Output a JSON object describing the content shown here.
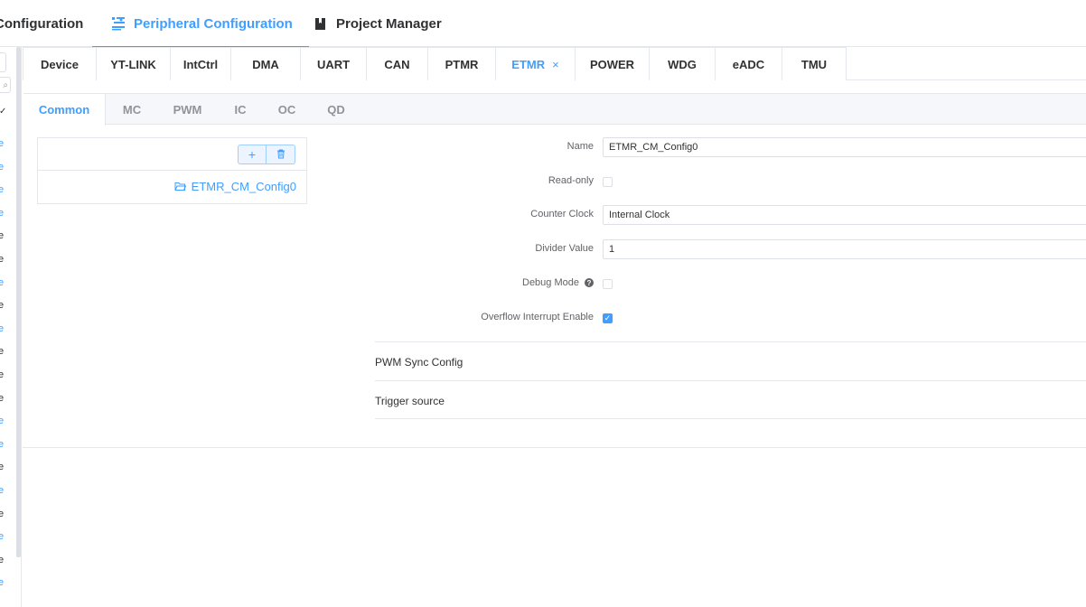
{
  "topnav": {
    "tabs": [
      {
        "label": "Configuration",
        "icon": "none"
      },
      {
        "label": "Peripheral Configuration",
        "icon": "peripheral-icon"
      },
      {
        "label": "Project Manager",
        "icon": "book-icon"
      }
    ],
    "active_color": "#409eff"
  },
  "sidebar": {
    "items": [
      "e",
      "e",
      "e",
      "e",
      "e",
      "e",
      "e",
      "e",
      "e",
      "e",
      "e",
      "e",
      "e",
      "e",
      "e",
      "e",
      "e",
      "e",
      "e",
      "e"
    ]
  },
  "peripheral_tabs": [
    {
      "label": "Device"
    },
    {
      "label": "YT-LINK"
    },
    {
      "label": "IntCtrl"
    },
    {
      "label": "DMA"
    },
    {
      "label": "UART"
    },
    {
      "label": "CAN"
    },
    {
      "label": "PTMR"
    },
    {
      "label": "ETMR",
      "close": "×"
    },
    {
      "label": "POWER"
    },
    {
      "label": "WDG"
    },
    {
      "label": "eADC"
    },
    {
      "label": "TMU"
    }
  ],
  "inner_tabs": [
    "Common",
    "MC",
    "PWM",
    "IC",
    "OC",
    "QD"
  ],
  "config_list": {
    "add_label": "+",
    "entries": [
      "ETMR_CM_Config0"
    ]
  },
  "form": {
    "name": {
      "label": "Name",
      "value": "ETMR_CM_Config0"
    },
    "read_only": {
      "label": "Read-only",
      "checked": false
    },
    "counter_clock": {
      "label": "Counter Clock",
      "value": "Internal Clock"
    },
    "divider_value": {
      "label": "Divider Value",
      "value": "1"
    },
    "debug_mode": {
      "label": "Debug Mode",
      "help": "?",
      "checked": false
    },
    "overflow_interrupt": {
      "label": "Overflow Interrupt Enable",
      "checked": true
    }
  },
  "sections": [
    "PWM Sync Config",
    "Trigger source"
  ]
}
